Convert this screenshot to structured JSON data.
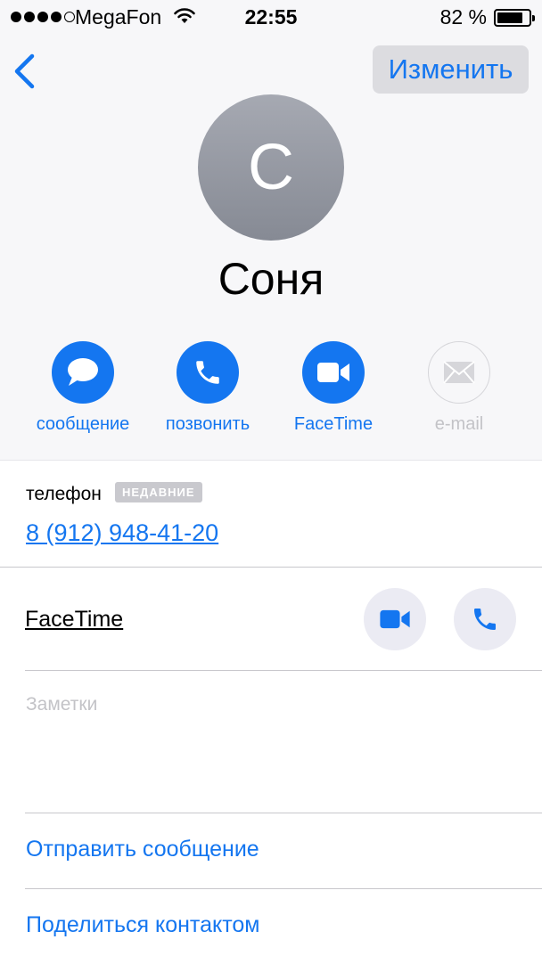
{
  "status_bar": {
    "signal_dots": 5,
    "signal_filled": 4,
    "carrier": "MegaFon",
    "time": "22:55",
    "battery_percent": "82 %",
    "battery_level": 0.82
  },
  "nav": {
    "back_icon": "chevron-left-icon",
    "edit_label": "Изменить"
  },
  "contact": {
    "initial": "С",
    "name": "Соня"
  },
  "actions": [
    {
      "label": "сообщение",
      "icon": "message-bubble-icon",
      "enabled": true
    },
    {
      "label": "позвонить",
      "icon": "phone-icon",
      "enabled": true
    },
    {
      "label": "FaceTime",
      "icon": "video-camera-icon",
      "enabled": true
    },
    {
      "label": "e-mail",
      "icon": "envelope-icon",
      "enabled": false
    }
  ],
  "phone": {
    "type": "телефон",
    "badge": "НЕДАВНИЕ",
    "number": "8 (912) 948-41-20"
  },
  "facetime": {
    "label": "FaceTime",
    "video_icon": "video-camera-icon",
    "audio_icon": "phone-icon"
  },
  "notes": {
    "placeholder": "Заметки"
  },
  "links": {
    "send_message": "Отправить сообщение",
    "share_contact": "Поделиться контактом"
  },
  "colors": {
    "accent": "#1476f0",
    "disabled": "#c3c3c7",
    "header_bg": "#f7f7f9"
  }
}
